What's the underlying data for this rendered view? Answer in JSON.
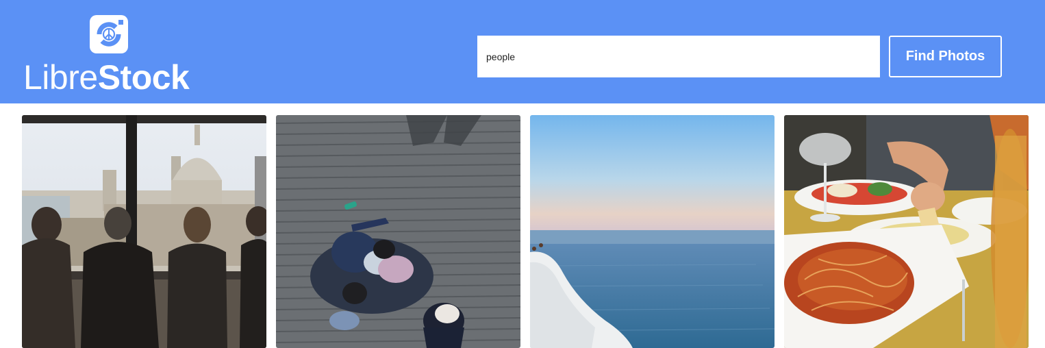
{
  "brand": {
    "name_light": "Libre",
    "name_bold": "Stock",
    "logo_icon": "camera-peace-icon"
  },
  "search": {
    "value": "people",
    "button_label": "Find Photos"
  },
  "photos": [
    {
      "subject": "people-at-window-cathedral-view"
    },
    {
      "subject": "people-sitting-on-wooden-deck"
    },
    {
      "subject": "person-on-white-cliff-by-sea"
    },
    {
      "subject": "table-with-pasta-and-wine"
    }
  ],
  "colors": {
    "header_bg": "#5b91f5",
    "white": "#ffffff"
  }
}
